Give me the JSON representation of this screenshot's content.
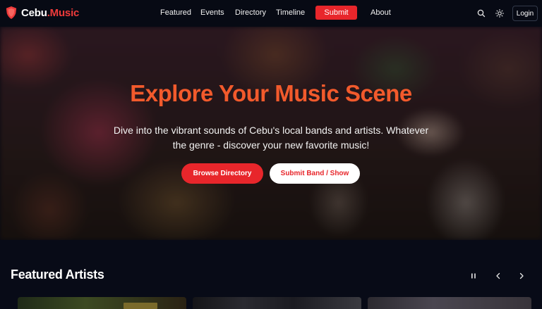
{
  "brand": {
    "name_part1": "Cebu",
    "name_dot": ".",
    "name_part2": "Music"
  },
  "nav": {
    "links": [
      "Featured",
      "Events",
      "Directory",
      "Timeline"
    ],
    "submit_label": "Submit",
    "about_label": "About",
    "login_label": "Login"
  },
  "hero": {
    "title": "Explore Your Music Scene",
    "subtitle": "Dive into the vibrant sounds of Cebu's local bands and artists. Whatever the genre - discover your new favorite music!",
    "primary_button": "Browse Directory",
    "secondary_button": "Submit Band / Show"
  },
  "featured": {
    "title": "Featured Artists",
    "controls": [
      "pause-icon",
      "chevron-left-icon",
      "chevron-right-icon"
    ]
  },
  "colors": {
    "accent": "#e8262b",
    "title": "#f25a2c",
    "background": "#080b17"
  }
}
